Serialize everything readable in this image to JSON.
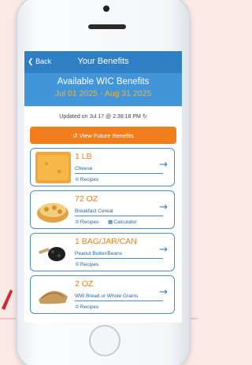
{
  "nav": {
    "back_label": "Back",
    "title": "Your Benefits"
  },
  "banner": {
    "title": "Available WIC Benefits",
    "dates": "Jul 01 2025 - Aug 31 2025"
  },
  "updated": {
    "text": "Updated on Jul 17 @ 2:38:18 PM"
  },
  "future_button": {
    "label": "View Future Benefits"
  },
  "benefits": [
    {
      "qty": "1 LB",
      "name": "Cheese",
      "links": [
        "Recipes"
      ]
    },
    {
      "qty": "72 OZ",
      "name": "Breakfast Cereal",
      "links": [
        "Recipes",
        "Calculator"
      ]
    },
    {
      "qty": "1 BAG/JAR/CAN",
      "name": "Peanut Butter/Beans",
      "links": [
        "Recipes"
      ]
    },
    {
      "qty": "2 OZ",
      "name": "WW Bread or Whole Grains",
      "links": [
        "Recipes"
      ]
    }
  ],
  "colors": {
    "nav": "#2e7fc4",
    "banner": "#4295d8",
    "accent": "#f07e1c",
    "date": "#f5b12b"
  }
}
